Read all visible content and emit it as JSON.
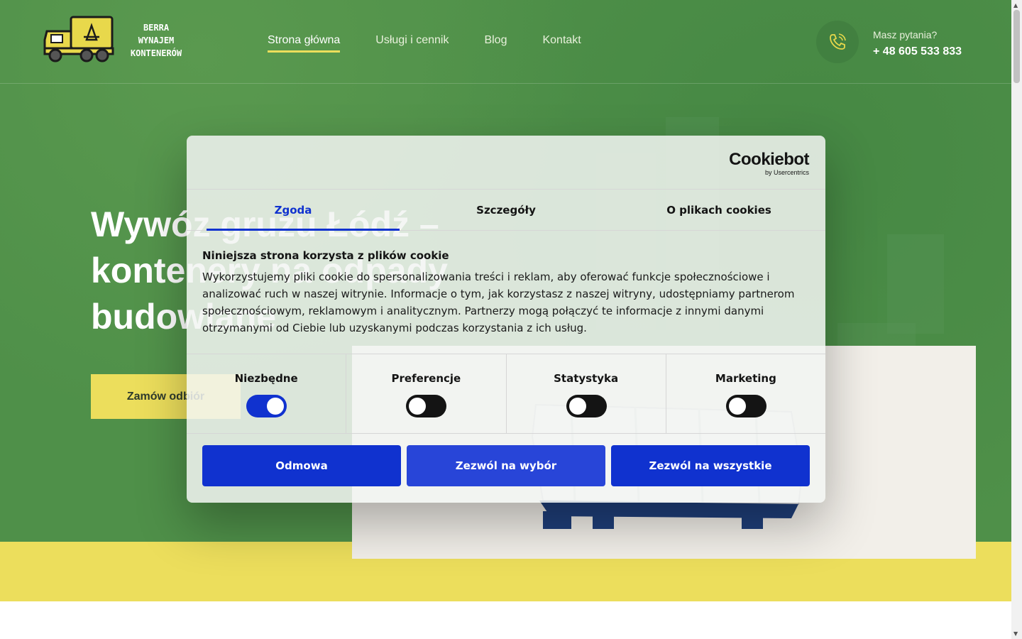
{
  "logo": {
    "lines": [
      "BERRA",
      "WYNAJEM",
      "KONTENERÓW"
    ],
    "icon": "garbage-truck-icon"
  },
  "nav": {
    "items": [
      {
        "label": "Strona główna",
        "active": true
      },
      {
        "label": "Usługi i cennik",
        "active": false
      },
      {
        "label": "Blog",
        "active": false
      },
      {
        "label": "Kontakt",
        "active": false
      }
    ]
  },
  "contact": {
    "question": "Masz pytania?",
    "phone": "+ 48 605 533 833",
    "icon": "phone-icon"
  },
  "hero": {
    "title": "Wywóz gruzu Łódź – kontenery na odpady budowlane",
    "cta_label": "Zamów odbiór"
  },
  "cookie_dialog": {
    "brand": "Cookiebot",
    "brand_sub": "by Usercentrics",
    "tabs": [
      {
        "label": "Zgoda",
        "active": true
      },
      {
        "label": "Szczegóły",
        "active": false
      },
      {
        "label": "O plikach cookies",
        "active": false
      }
    ],
    "heading": "Niniejsza strona korzysta z plików cookie",
    "body": "Wykorzystujemy pliki cookie do spersonalizowania treści i reklam, aby oferować funkcje społecznościowe i analizować ruch w naszej witrynie. Informacje o tym, jak korzystasz z naszej witryny, udostępniamy partnerom społecznościowym, reklamowym i analitycznym. Partnerzy mogą połączyć te informacje z innymi danymi otrzymanymi od Ciebie lub uzyskanymi podczas korzystania z ich usług.",
    "toggles": [
      {
        "label": "Niezbędne",
        "on": true
      },
      {
        "label": "Preferencje",
        "on": false
      },
      {
        "label": "Statystyka",
        "on": false
      },
      {
        "label": "Marketing",
        "on": false
      }
    ],
    "buttons": {
      "deny": "Odmowa",
      "allow_selection": "Zezwól na wybór",
      "allow_all": "Zezwól na wszystkie"
    }
  },
  "colors": {
    "hero_green": "#4f9049",
    "accent_yellow": "#ecde5c",
    "cookie_blue": "#1032cf"
  }
}
